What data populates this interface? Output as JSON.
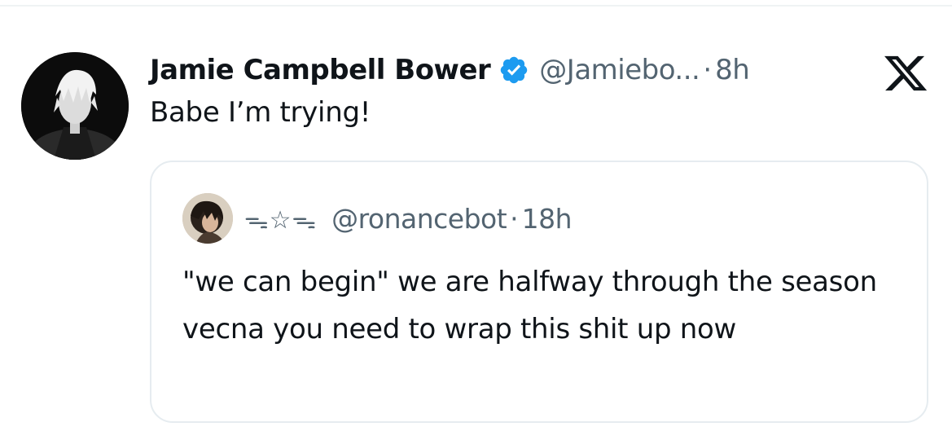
{
  "tweet": {
    "display_name": "Jamie Campbell Bower",
    "handle": "@Jamiebo...",
    "separator": "·",
    "time": "8h",
    "text": "Babe I’m trying!",
    "verified": true,
    "verified_icon": "verified-badge-icon",
    "platform_icon": "x-logo-icon"
  },
  "quoted_tweet": {
    "display_name": "ᯓ☆ᯓ",
    "handle": "@ronancebot",
    "separator": "·",
    "time": "18h",
    "text": "\"we can begin\" we are halfway through the season vecna you need to wrap this shit up now"
  },
  "colors": {
    "text_primary": "#0f1419",
    "text_secondary": "#536471",
    "verified_blue": "#1d9bf0",
    "border": "#e6ecf0"
  }
}
